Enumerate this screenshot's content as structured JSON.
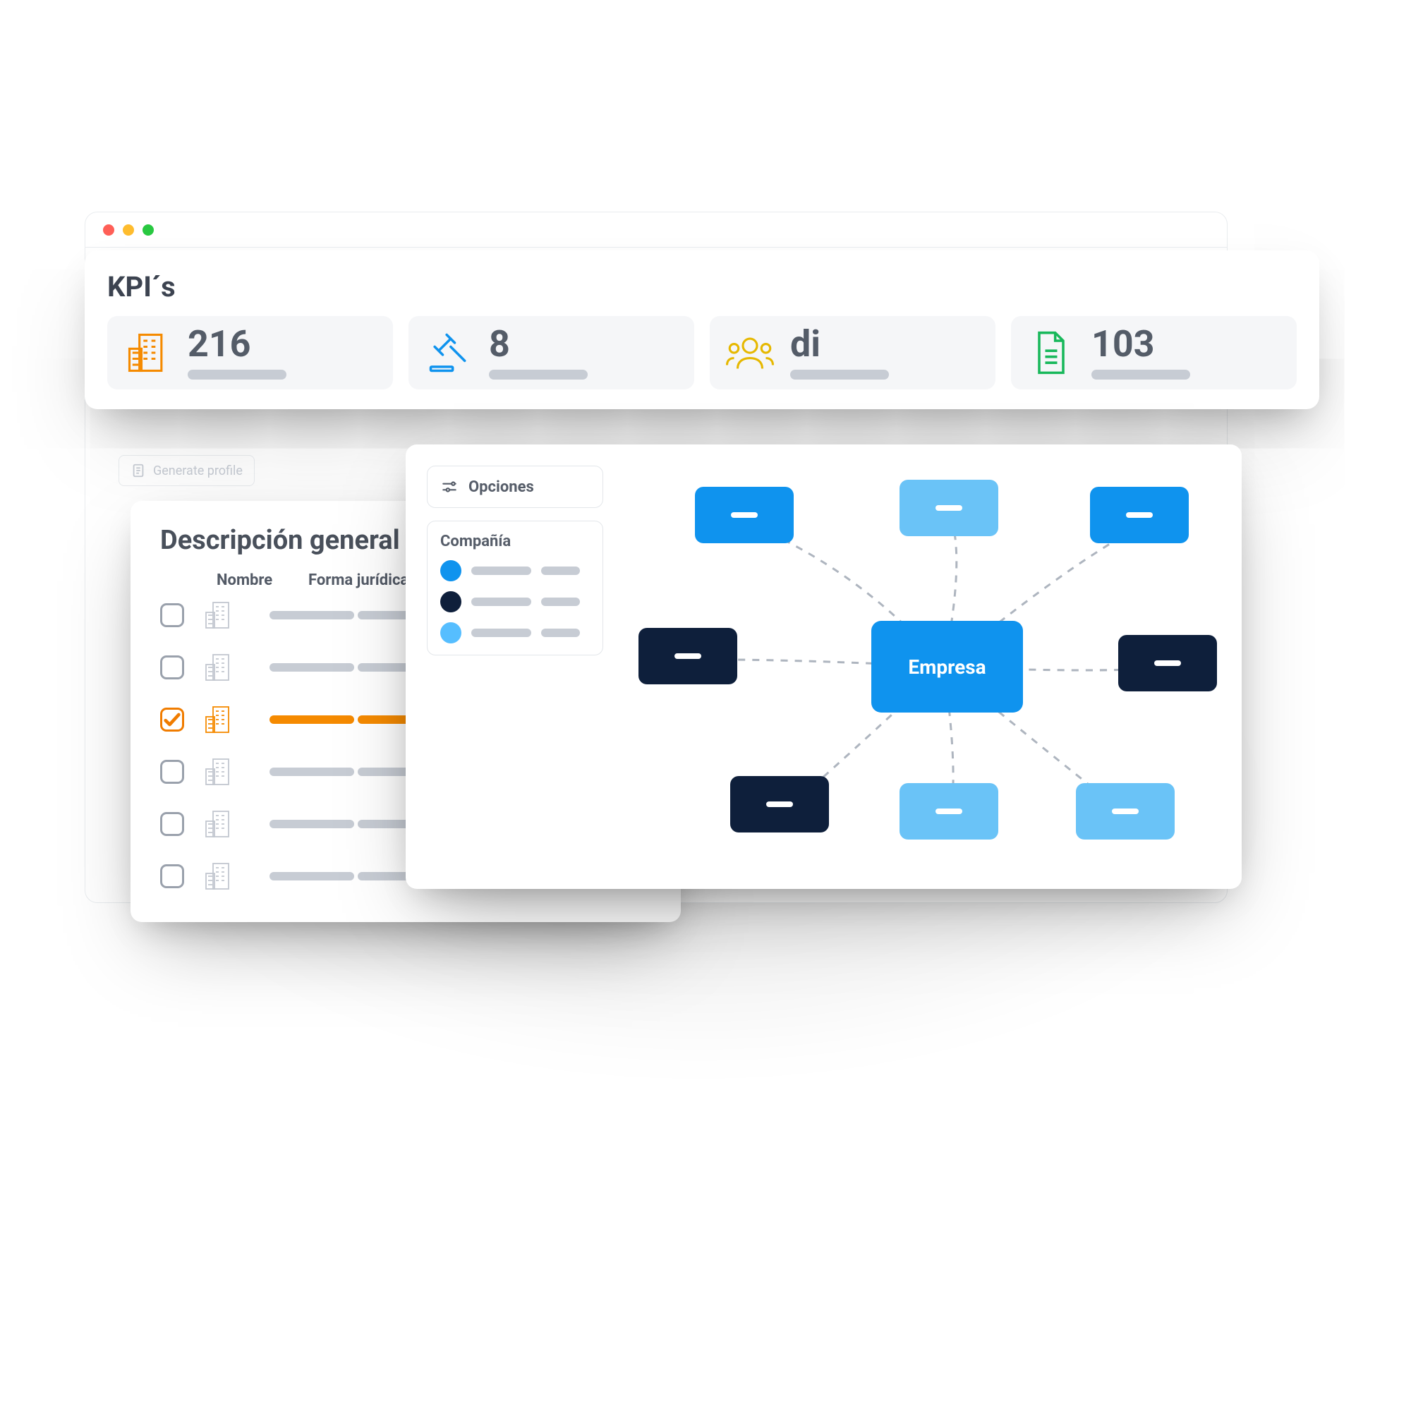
{
  "kpi": {
    "title": "KPI´s",
    "items": [
      {
        "value": "216",
        "icon": "building",
        "color": "#f58a00"
      },
      {
        "value": "8",
        "icon": "gavel",
        "color": "#0f93ee"
      },
      {
        "value": "di",
        "icon": "people",
        "color": "#e6b800"
      },
      {
        "value": "103",
        "icon": "document",
        "color": "#18b85b"
      }
    ]
  },
  "generate_profile": "Generate profile",
  "overview": {
    "title": "Descripción general",
    "columns": {
      "name": "Nombre",
      "form": "Forma jurídica"
    },
    "rows": [
      {
        "checked": false,
        "highlight": false
      },
      {
        "checked": false,
        "highlight": false
      },
      {
        "checked": true,
        "highlight": true
      },
      {
        "checked": false,
        "highlight": false
      },
      {
        "checked": false,
        "highlight": false
      },
      {
        "checked": false,
        "highlight": false
      }
    ]
  },
  "diagram": {
    "options_label": "Opciones",
    "legend_title": "Compañía",
    "center_label": "Empresa",
    "legend": [
      {
        "color": "#0f93ee"
      },
      {
        "color": "#0e1f3b"
      },
      {
        "color": "#56beff"
      }
    ]
  }
}
